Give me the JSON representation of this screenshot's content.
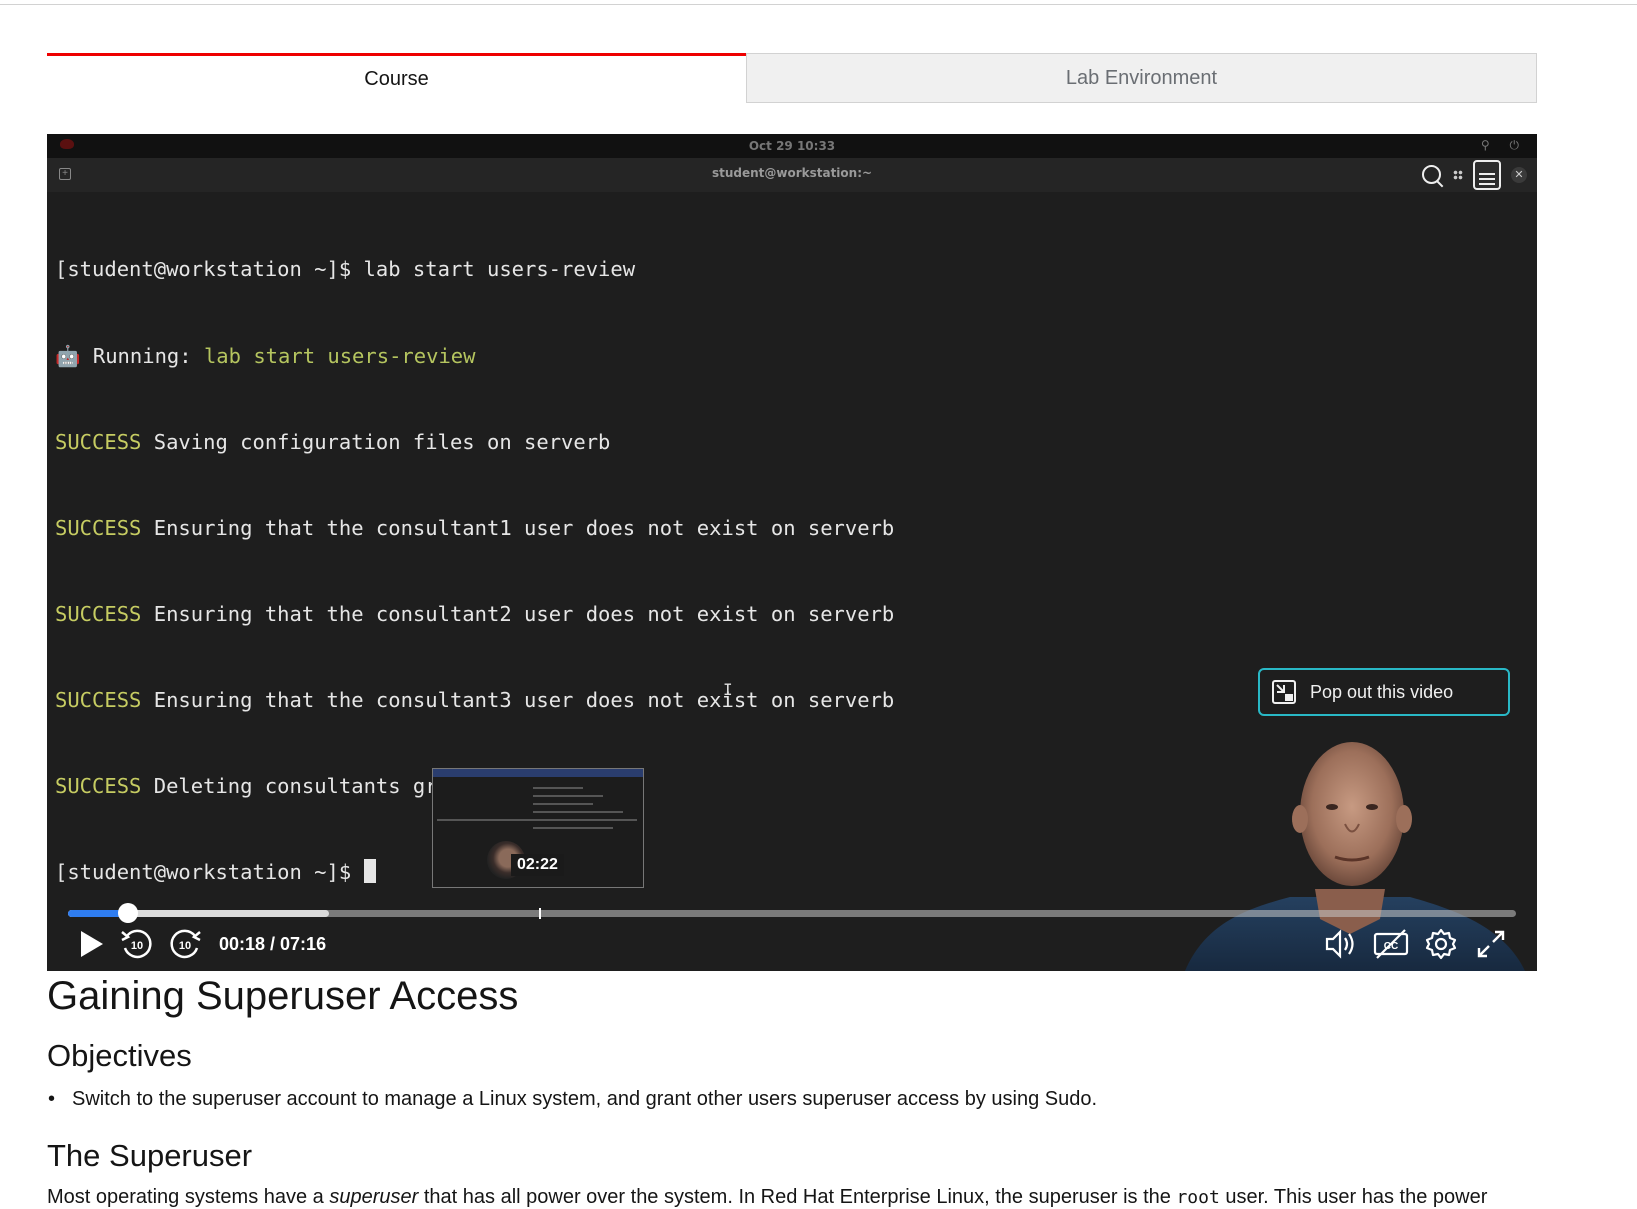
{
  "tabs": {
    "course": "Course",
    "lab_environment": "Lab Environment"
  },
  "video": {
    "desktop_clock": "Oct 29  10:33",
    "terminal_title": "student@workstation:~",
    "terminal_lines": [
      {
        "prefix": "",
        "text": "[student@workstation ~]$ lab start users-review"
      },
      {
        "prefix": "🤖 Running: ",
        "highlight": "lab start users-review"
      },
      {
        "prefix": "SUCCESS",
        "text": " Saving configuration files on serverb"
      },
      {
        "prefix": "SUCCESS",
        "text": " Ensuring that the consultant1 user does not exist on serverb"
      },
      {
        "prefix": "SUCCESS",
        "text": " Ensuring that the consultant2 user does not exist on serverb"
      },
      {
        "prefix": "SUCCESS",
        "text": " Ensuring that the consultant3 user does not exist on serverb"
      },
      {
        "prefix": "SUCCESS",
        "text": " Deleting consultants group on serverb"
      },
      {
        "prefix": "",
        "text": "[student@workstation ~]$ "
      }
    ],
    "popout_label": "Pop out this video",
    "preview_time": "02:22",
    "time_display": "00:18 / 07:16",
    "progress": {
      "current_seconds": 18,
      "duration_seconds": 436,
      "buffered_fraction": 0.18,
      "hover_fraction": 0.325
    },
    "accent_color": "#2f7df0",
    "controls": [
      "play-icon",
      "rewind-10-icon",
      "forward-10-icon",
      "volume-icon",
      "captions-off-icon",
      "settings-icon",
      "fullscreen-icon"
    ]
  },
  "content": {
    "title": "Gaining Superuser Access",
    "objectives_heading": "Objectives",
    "objective_1": "Switch to the superuser account to manage a Linux system, and grant other users superuser access by using Sudo.",
    "superuser_heading": "The Superuser",
    "para_start": "Most operating systems have a ",
    "para_em": "superuser",
    "para_mid": " that has all power over the system. In Red Hat Enterprise Linux, the superuser is the ",
    "para_code": "root",
    "para_end": " user. This user has the power"
  }
}
